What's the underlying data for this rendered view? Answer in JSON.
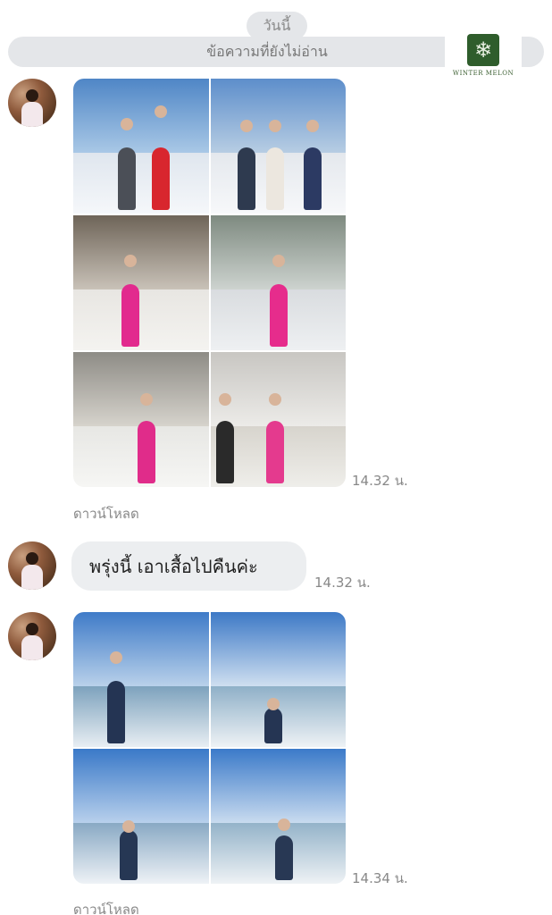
{
  "header": {
    "day_label": "วันนี้",
    "unread_label": "ข้อความที่ยังไม่อ่าน"
  },
  "watermark": {
    "brand": "WINTER MELON"
  },
  "messages": [
    {
      "type": "photos",
      "count": 6,
      "time": "14.32 น.",
      "download_label": "ดาวน์โหลด"
    },
    {
      "type": "text",
      "text": "พรุ่งนี้  เอาเสื้อไปคืนค่ะ",
      "time": "14.32 น."
    },
    {
      "type": "photos",
      "count": 4,
      "time": "14.34 น.",
      "download_label": "ดาวน์โหลด"
    }
  ],
  "colors": {
    "pill_bg": "#e4e6e9",
    "bubble_bg": "#eceef0",
    "meta_text": "#888888",
    "brand_green": "#2f5d2c"
  },
  "icons": [
    "snowflake-icon"
  ]
}
